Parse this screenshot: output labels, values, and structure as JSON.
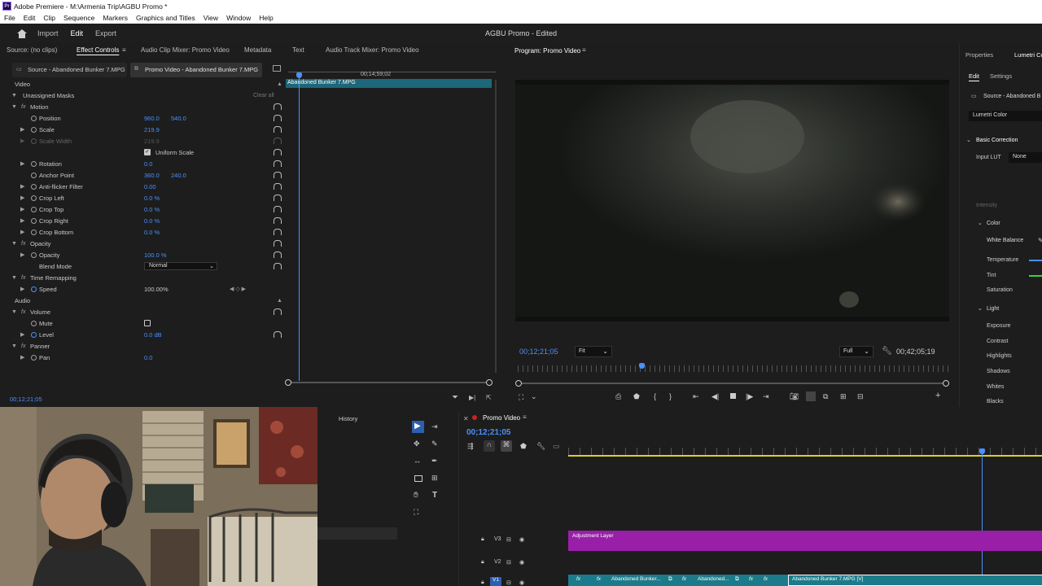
{
  "window": {
    "title": "Adobe Premiere - M:\\Armenia Trip\\AGBU Promo *"
  },
  "menubar": [
    "File",
    "Edit",
    "Clip",
    "Sequence",
    "Markers",
    "Graphics and Titles",
    "View",
    "Window",
    "Help"
  ],
  "header": {
    "tabs": [
      "Import",
      "Edit",
      "Export"
    ],
    "active_tab": "Edit",
    "project_title": "AGBU Promo - Edited"
  },
  "source_panel": {
    "tabs": [
      "Source: (no clips)",
      "Effect Controls",
      "Audio Clip Mixer: Promo Video",
      "Metadata",
      "Text",
      "Audio Track Mixer: Promo Video"
    ],
    "active_tab": "Effect Controls",
    "clip_tabs": [
      "Source - Abandoned Bunker 7.MPG",
      "Promo Video - Abandoned Bunker 7.MPG"
    ],
    "mini_timeline": {
      "timecode": "00;14;59;02",
      "clip_name": "Abandoned Bunker 7.MPG"
    },
    "sections": {
      "video": "Video",
      "audio": "Audio"
    },
    "unassigned_masks": "Unassigned Masks",
    "clear_all": "Clear all",
    "motion": "Motion",
    "position": {
      "label": "Position",
      "x": "960.0",
      "y": "540.0"
    },
    "scale": {
      "label": "Scale",
      "value": "219.9"
    },
    "scale_width": {
      "label": "Scale Width",
      "value": "219.9"
    },
    "uniform_scale": "Uniform Scale",
    "rotation": {
      "label": "Rotation",
      "value": "0.0"
    },
    "anchor_point": {
      "label": "Anchor Point",
      "x": "360.0",
      "y": "240.0"
    },
    "anti_flicker": {
      "label": "Anti-flicker Filter",
      "value": "0.00"
    },
    "crop_left": {
      "label": "Crop Left",
      "value": "0.0 %"
    },
    "crop_top": {
      "label": "Crop Top",
      "value": "0.0 %"
    },
    "crop_right": {
      "label": "Crop Right",
      "value": "0.0 %"
    },
    "crop_bottom": {
      "label": "Crop Bottom",
      "value": "0.0 %"
    },
    "opacity_fx": "Opacity",
    "opacity": {
      "label": "Opacity",
      "value": "100.0 %"
    },
    "blend_mode": {
      "label": "Blend Mode",
      "value": "Normal"
    },
    "time_remapping": "Time Remapping",
    "speed": {
      "label": "Speed",
      "value": "100.00%"
    },
    "volume": "Volume",
    "mute": "Mute",
    "level": {
      "label": "Level",
      "value": "0.0 dB"
    },
    "panner": "Panner",
    "pan": {
      "label": "Pan",
      "value": "0.0"
    },
    "timecode": "00;12;21;05"
  },
  "program_monitor": {
    "title": "Program: Promo Video",
    "timecode": "00;12;21;05",
    "fit": "Fit",
    "resolution": "Full",
    "duration": "00;42;05;19"
  },
  "lumetri": {
    "tabs": [
      "Properties",
      "Lumetri Co"
    ],
    "sub_tabs": [
      "Edit",
      "Settings"
    ],
    "source": "Source - Abandoned B",
    "effect": "Lumetri Color",
    "basic_correction": "Basic Correction",
    "input_lut": {
      "label": "Input LUT",
      "value": "None"
    },
    "intensity": "Intensity",
    "color": "Color",
    "white_balance": "White Balance",
    "color_items": [
      "Temperature",
      "Tint",
      "Saturation"
    ],
    "light": "Light",
    "light_items": [
      "Exposure",
      "Contrast",
      "Highlights",
      "Shadows",
      "Whites",
      "Blacks"
    ],
    "colors": {
      "temperature": "#4a90ff",
      "tint": "#3bd13b"
    }
  },
  "history": {
    "title": "History"
  },
  "timeline": {
    "title": "Promo Video",
    "timecode": "00;12;21;05",
    "tracks": [
      "V3",
      "V2",
      "V1"
    ],
    "adjustment_layer": "Adjustment Layer",
    "clips": [
      "Abandoned Bunker...",
      "Abandoned...",
      "Abandoned Bunker 7.MPG [V]"
    ],
    "colors": {
      "adjustment": "#9a1fa8",
      "clip": "#1c7b8b"
    }
  }
}
